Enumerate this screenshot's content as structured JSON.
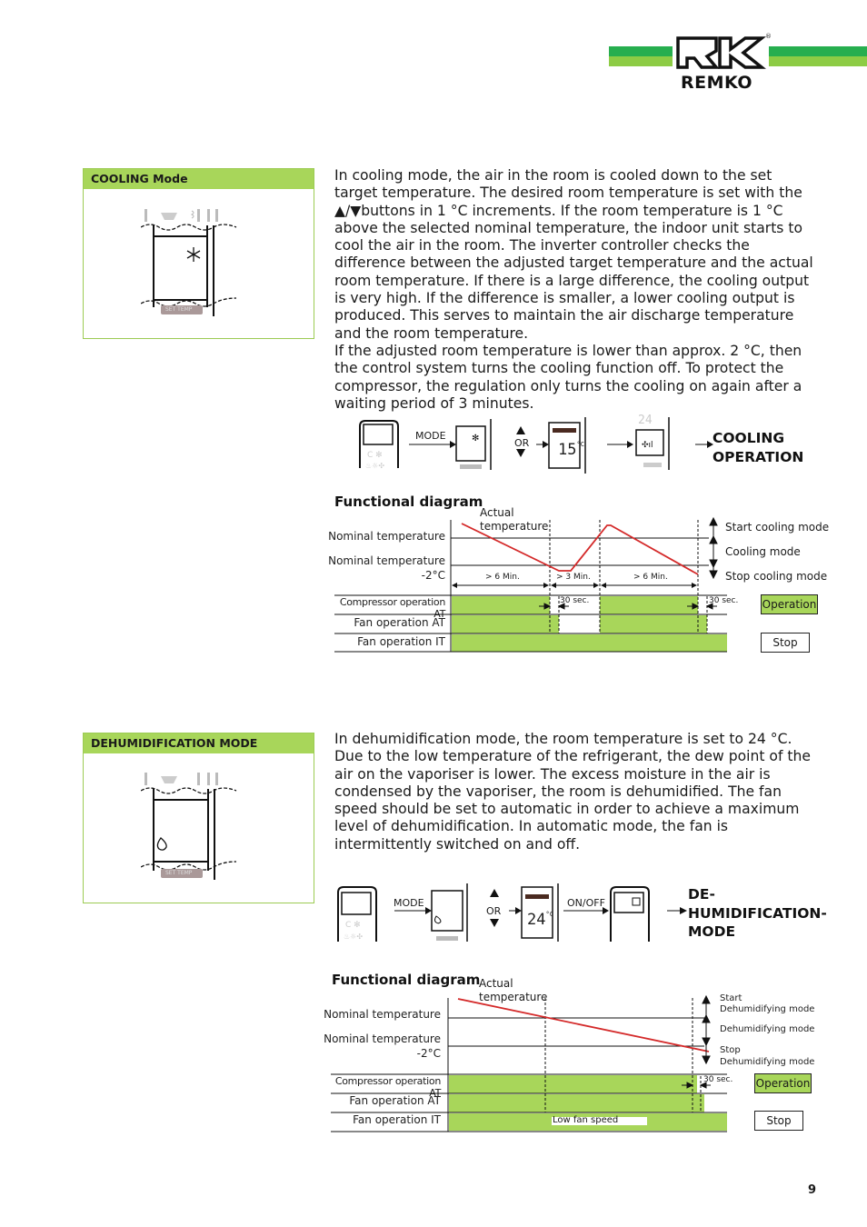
{
  "header": {
    "brand": "REMKO",
    "registered_mark": "®",
    "colors": {
      "stripe_dark": "#27ae4f",
      "stripe_light": "#8dcc45",
      "accent_green": "#a8d65a",
      "curve_red": "#d42a2a"
    }
  },
  "cooling": {
    "box_title": "COOLING Mode",
    "display_label": "SET TEMP",
    "paragraph": "In cooling mode, the air in the room is cooled down to the set target temperature. The desired room temperature is set with the ▲/▼buttons in 1 °C increments. If the room temperature is 1 °C above the selected nominal temperature, the indoor unit starts to cool the air in the room. The inverter controller checks the difference between the adjusted target temperature and the actual room temperature. If there is a large difference, the cooling output is very high. If the difference is smaller, a lower cooling output is produced. This serves to maintain the air discharge temperature and the room temperature.\nIf the adjusted room temperature is lower than approx. 2 °C, then the control system turns the cooling function off. To protect the compressor, the regulation only turns the cooling on again after a waiting period of 3 minutes.",
    "sequence": {
      "step1_label": "MODE",
      "or_label": "OR",
      "display_value": "15",
      "display_unit": "°C",
      "top_value": "24",
      "result_line1": "COOLING",
      "result_line2": "OPERATION"
    },
    "diagram": {
      "title": "Functional diagram",
      "actual_temp_line1": "Actual",
      "actual_temp_line2": "temperature",
      "nominal_label": "Nominal temperature",
      "nominal_minus_line1": "Nominal temperature",
      "nominal_minus_line2": "-2°C",
      "intervals": [
        "> 6 Min.",
        "> 3 Min.",
        "> 6 Min."
      ],
      "rows": [
        "Compressor operation AT",
        "Fan operation AT",
        "Fan operation IT"
      ],
      "delay_label": "30 sec.",
      "right_labels": [
        "Start cooling mode",
        "Cooling mode",
        "Stop cooling mode"
      ],
      "legend_operation": "Operation",
      "legend_stop": "Stop"
    }
  },
  "dehumidification": {
    "box_title": "DEHUMIDIFICATION MODE",
    "display_label": "SET TEMP",
    "paragraph": "In dehumidification mode, the room temperature is set to 24 °C. Due to the low temperature of the refrigerant, the dew point of the air on the vaporiser is lower. The excess moisture in the air is condensed by the vaporiser, the room is dehumidified. The fan speed should be set to automatic in order to achieve a maximum level of dehumidification. In automatic mode, the fan is intermittently switched on and off.",
    "sequence": {
      "step1_label": "MODE",
      "or_label": "OR",
      "display_value": "24",
      "display_unit": "°C",
      "step3_label": "ON/OFF",
      "result_line1": "DE-",
      "result_line2": "HUMIDIFICATION-",
      "result_line3": "MODE"
    },
    "diagram": {
      "title": "Functional diagram",
      "actual_temp_line1": "Actual",
      "actual_temp_line2": "temperature",
      "nominal_label": "Nominal temperature",
      "nominal_minus_line1": "Nominal temperature",
      "nominal_minus_line2": "-2°C",
      "rows": [
        "Compressor operation AT",
        "Fan operation AT",
        "Fan operation IT"
      ],
      "delay_label": "30 sec.",
      "low_fan_label": "Low fan speed",
      "right_labels": [
        "Start",
        "Dehumidifying mode",
        "Dehumidifying mode",
        "Stop",
        "Dehumidifying mode"
      ],
      "legend_operation": "Operation",
      "legend_stop": "Stop"
    }
  },
  "footer": {
    "page_number": "9"
  }
}
